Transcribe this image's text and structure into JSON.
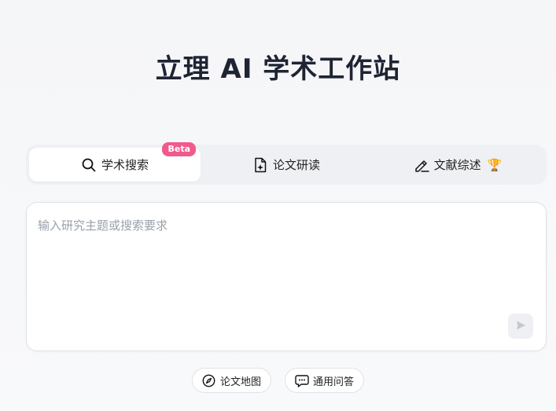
{
  "header": {
    "title": "立理 AI 学术工作站"
  },
  "tabs": [
    {
      "label": "学术搜索",
      "icon": "search-icon",
      "active": true,
      "badge": "Beta"
    },
    {
      "label": "论文研读",
      "icon": "document-sparkle-icon",
      "active": false
    },
    {
      "label": "文献综述",
      "icon": "pencil-icon",
      "active": false,
      "extra_icon": "trophy-icon"
    }
  ],
  "search": {
    "placeholder": "输入研究主题或搜索要求",
    "value": ""
  },
  "quick_actions": [
    {
      "label": "论文地图",
      "icon": "compass-icon"
    },
    {
      "label": "通用问答",
      "icon": "chat-icon"
    }
  ],
  "colors": {
    "badge": "#f05a8c",
    "title": "#1e2433",
    "tab_bg": "#eef0f3"
  }
}
